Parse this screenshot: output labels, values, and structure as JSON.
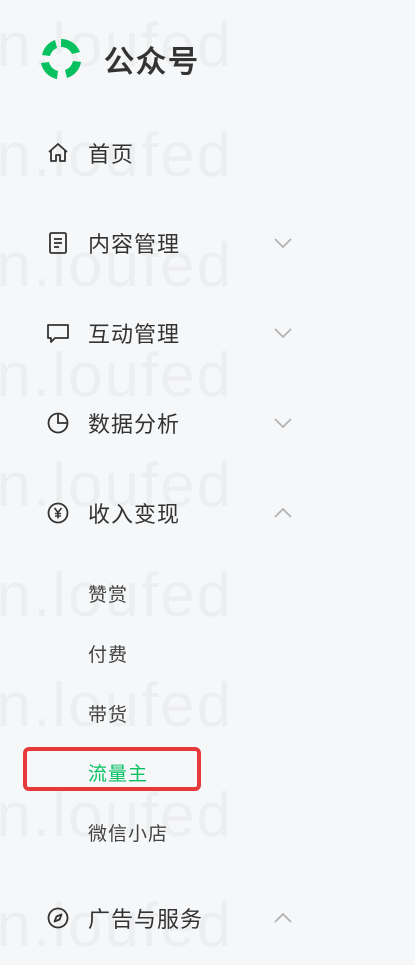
{
  "brand": {
    "name": "公众号",
    "logo_icon": "wechat-official-account-logo",
    "logo_color": "#07c160"
  },
  "menu": [
    {
      "label": "首页",
      "icon": "home-icon",
      "chevron": "none"
    },
    {
      "label": "内容管理",
      "icon": "document-icon",
      "chevron": "down"
    },
    {
      "label": "互动管理",
      "icon": "chat-bubble-icon",
      "chevron": "down"
    },
    {
      "label": "数据分析",
      "icon": "pie-chart-icon",
      "chevron": "down"
    },
    {
      "label": "收入变现",
      "icon": "yen-icon",
      "chevron": "up"
    },
    {
      "label": "广告与服务",
      "icon": "compass-icon",
      "chevron": "up"
    }
  ],
  "submenu_income": [
    {
      "label": "赞赏"
    },
    {
      "label": "付费"
    },
    {
      "label": "带货"
    },
    {
      "label": "流量主",
      "active": true
    },
    {
      "label": "微信小店"
    }
  ],
  "colors": {
    "accent": "#07c160",
    "text": "#333333",
    "chevron": "#b3b3b3",
    "highlight_border": "#e8393a",
    "background": "#f6f7f8"
  }
}
